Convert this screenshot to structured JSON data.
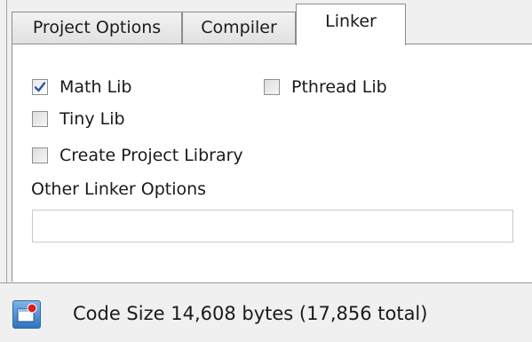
{
  "tabs": [
    {
      "label": "Project Options",
      "active": false
    },
    {
      "label": "Compiler",
      "active": false
    },
    {
      "label": "Linker",
      "active": true
    }
  ],
  "linker": {
    "options": [
      {
        "label": "Math Lib",
        "checked": true
      },
      {
        "label": "Pthread Lib",
        "checked": false
      },
      {
        "label": "Tiny Lib",
        "checked": false
      },
      {
        "label": "Create Project Library",
        "checked": false
      }
    ],
    "other_options_label": "Other Linker Options",
    "other_options_value": ""
  },
  "status": {
    "icon": "project-status-icon",
    "text": "Code Size 14,608 bytes (17,856 total)"
  },
  "colors": {
    "check_mark": "#2b55a6",
    "status_icon_blue": "#2f74c0",
    "status_icon_red": "#d62020"
  }
}
